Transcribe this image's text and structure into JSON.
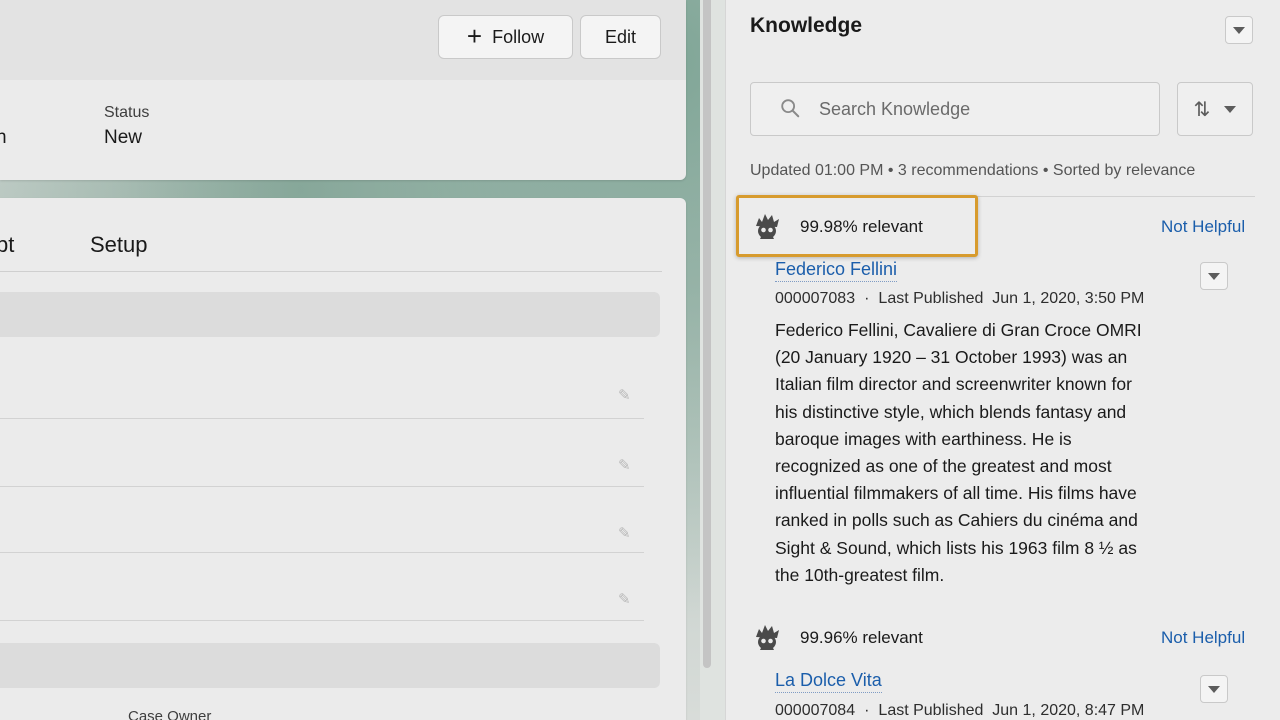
{
  "header": {
    "follow_label": "Follow",
    "edit_label": "Edit",
    "highlight_fragment": "n",
    "status_label": "Status",
    "status_value": "New"
  },
  "details": {
    "tab_fragment": "pt",
    "tab_setup": "Setup",
    "case_owner_label": "Case Owner"
  },
  "knowledge": {
    "title": "Knowledge",
    "search_placeholder": "Search Knowledge",
    "meta": "Updated 01:00 PM • 3 recommendations • Sorted by relevance",
    "accent_color": "#d79b2e",
    "link_color": "#1b5eab",
    "articles": [
      {
        "relevance": "99.98% relevant",
        "not_helpful": "Not Helpful",
        "title": "Federico Fellini",
        "number": "000007083",
        "published_label": "Last Published",
        "published_date": "Jun 1, 2020, 3:50 PM",
        "lines": [
          "Federico Fellini, Cavaliere di Gran Croce OMRI",
          "(20 January 1920 – 31 October 1993) was an",
          "Italian film director and screenwriter known for",
          "his distinctive style, which blends fantasy and",
          "baroque images with earthiness. He is",
          "recognized as one of the greatest and most",
          "influential filmmakers of all time. His films have",
          "ranked in polls such as Cahiers du cinéma and",
          "Sight & Sound, which lists his 1963 film 8 ½ as",
          "the 10th-greatest film."
        ]
      },
      {
        "relevance": "99.96% relevant",
        "not_helpful": "Not Helpful",
        "title": "La Dolce Vita",
        "number": "000007084",
        "published_label": "Last Published",
        "published_date": "Jun 1, 2020, 8:47 PM"
      }
    ]
  }
}
